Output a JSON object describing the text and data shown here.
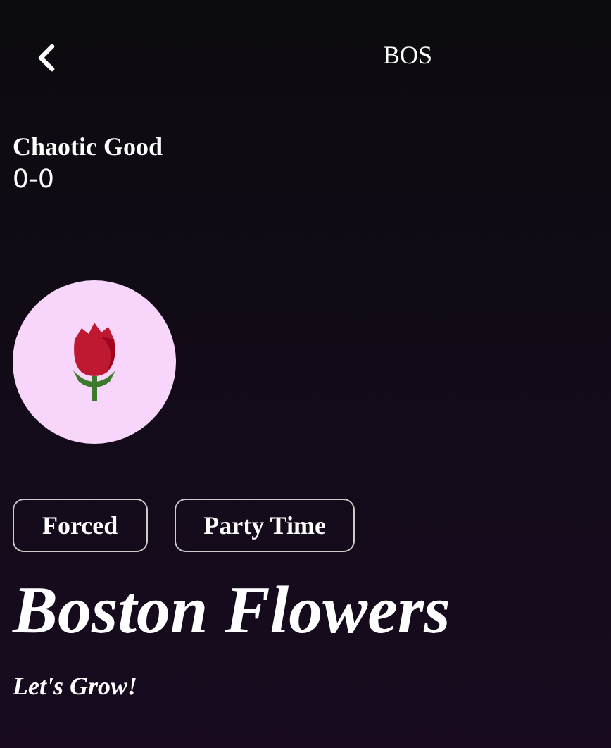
{
  "header": {
    "title": "BOS"
  },
  "team": {
    "alignment": "Chaotic Good",
    "record": "0-0"
  },
  "tags": [
    "Forced",
    "Party Time"
  ],
  "name": "Boston Flowers",
  "motto": "Let's Grow!"
}
